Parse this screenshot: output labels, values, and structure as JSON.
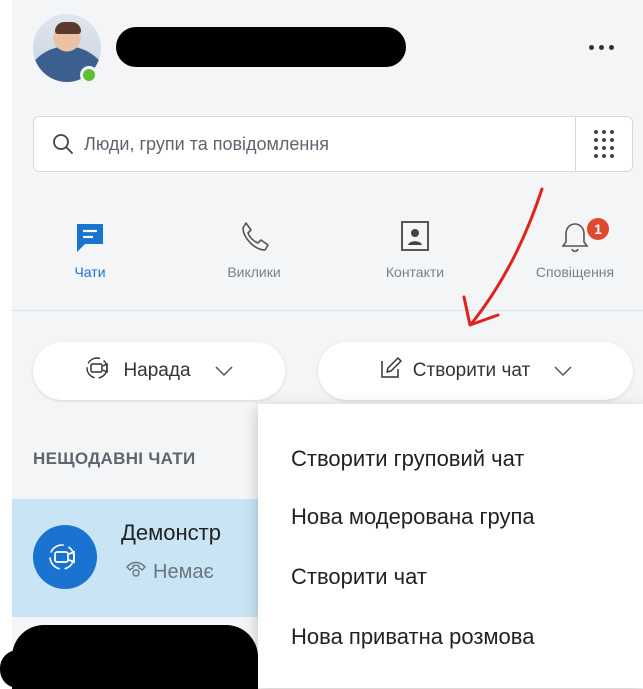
{
  "header": {
    "more_glyph": "..."
  },
  "search": {
    "placeholder": "Люди, групи та повідомлення"
  },
  "nav": {
    "items": [
      {
        "label": "Чати",
        "icon": "chat-icon",
        "active": true
      },
      {
        "label": "Виклики",
        "icon": "phone-icon",
        "active": false
      },
      {
        "label": "Контакти",
        "icon": "contacts-icon",
        "active": false
      },
      {
        "label": "Сповіщення",
        "icon": "bell-icon",
        "active": false,
        "badge": "1"
      }
    ]
  },
  "actions": {
    "meeting_label": "Нарада",
    "new_chat_label": "Створити чат"
  },
  "recent": {
    "title": "НЕЩОДАВНІ ЧАТИ",
    "chats": [
      {
        "name": "Демонстр",
        "subtitle": "Немає"
      }
    ]
  },
  "dropdown": {
    "items": [
      "Створити груповий чат",
      "Нова модерована група",
      "Створити чат",
      "Нова приватна розмова"
    ]
  },
  "colors": {
    "accent": "#1a73d0",
    "presence": "#5bc236",
    "badge": "#e0482f",
    "selected_row": "#c9e4f4",
    "annotation": "#e0231a"
  }
}
